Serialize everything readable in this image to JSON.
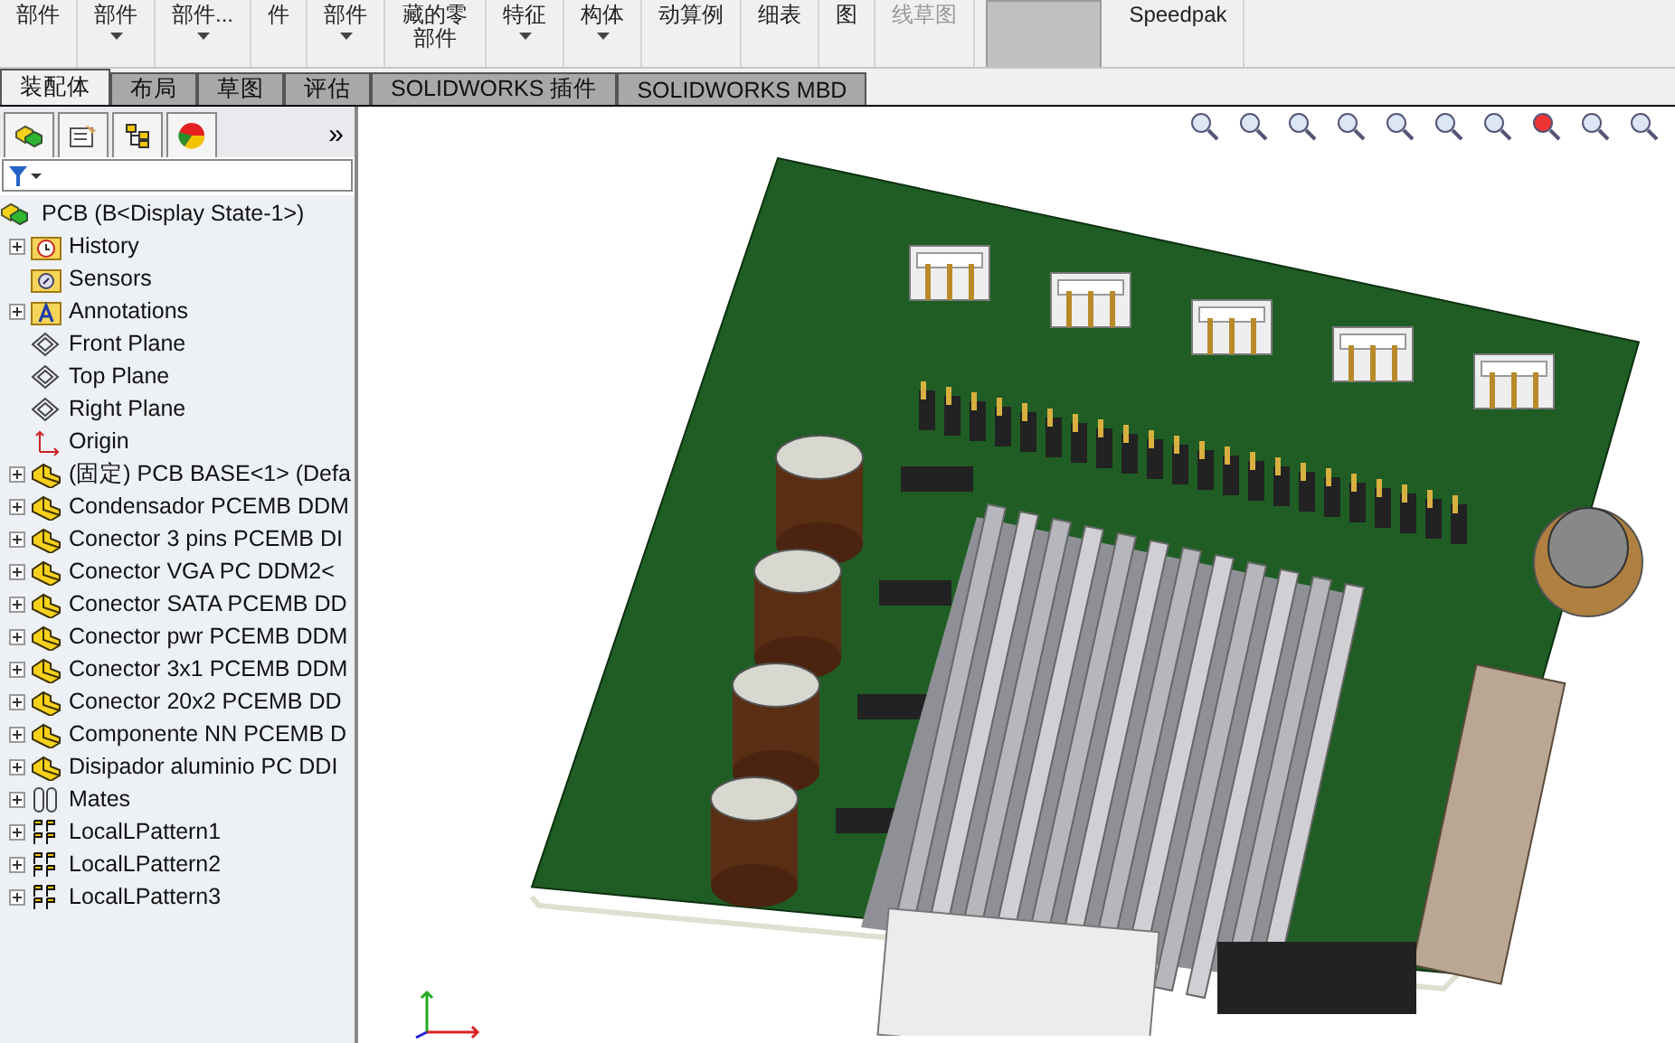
{
  "ribbon": [
    {
      "label": "部件",
      "caret": false,
      "disabled": false
    },
    {
      "label": "部件",
      "caret": true,
      "disabled": false
    },
    {
      "label": "部件...",
      "caret": true,
      "disabled": false
    },
    {
      "label": "件",
      "caret": false,
      "disabled": false
    },
    {
      "label": "部件",
      "caret": true,
      "disabled": false
    },
    {
      "label": "藏的零部件",
      "caret": false,
      "disabled": false
    },
    {
      "label": "特征",
      "caret": true,
      "disabled": false
    },
    {
      "label": "构体",
      "caret": true,
      "disabled": false
    },
    {
      "label": "动算例",
      "caret": false,
      "disabled": false
    },
    {
      "label": "细表",
      "caret": false,
      "disabled": false
    },
    {
      "label": "图",
      "caret": false,
      "disabled": false
    },
    {
      "label": "线草图",
      "caret": false,
      "disabled": true
    },
    {
      "label": "Speedpak",
      "caret": false,
      "disabled": false
    }
  ],
  "tabs": [
    {
      "label": "装配体",
      "selected": true
    },
    {
      "label": "布局",
      "selected": false
    },
    {
      "label": "草图",
      "selected": false
    },
    {
      "label": "评估",
      "selected": false
    },
    {
      "label": "SOLIDWORKS 插件",
      "selected": false
    },
    {
      "label": "SOLIDWORKS MBD",
      "selected": false
    }
  ],
  "panel_more": "»",
  "tree": {
    "label": "PCB  (B<Display State-1>)",
    "kind": "assembly",
    "children": [
      {
        "label": "History",
        "kind": "history",
        "expandable": true
      },
      {
        "label": "Sensors",
        "kind": "sensors",
        "expandable": false
      },
      {
        "label": "Annotations",
        "kind": "annotations",
        "expandable": true
      },
      {
        "label": "Front Plane",
        "kind": "plane",
        "expandable": false
      },
      {
        "label": "Top Plane",
        "kind": "plane",
        "expandable": false
      },
      {
        "label": "Right Plane",
        "kind": "plane",
        "expandable": false
      },
      {
        "label": "Origin",
        "kind": "origin",
        "expandable": false
      },
      {
        "label": "(固定) PCB BASE<1> (Defa",
        "kind": "part",
        "expandable": true
      },
      {
        "label": "Condensador PCEMB DDM",
        "kind": "part",
        "expandable": true
      },
      {
        "label": "Conector 3 pins PCEMB DI",
        "kind": "part",
        "expandable": true
      },
      {
        "label": "Conector VGA PC DDM2<",
        "kind": "part",
        "expandable": true
      },
      {
        "label": "Conector SATA PCEMB DD",
        "kind": "part",
        "expandable": true
      },
      {
        "label": "Conector pwr PCEMB DDM",
        "kind": "part",
        "expandable": true
      },
      {
        "label": "Conector 3x1 PCEMB DDM",
        "kind": "part",
        "expandable": true
      },
      {
        "label": "Conector 20x2 PCEMB DD",
        "kind": "part",
        "expandable": true
      },
      {
        "label": "Componente NN PCEMB D",
        "kind": "part",
        "expandable": true
      },
      {
        "label": "Disipador aluminio PC DDI",
        "kind": "part",
        "expandable": true
      },
      {
        "label": "Mates",
        "kind": "mates",
        "expandable": true
      },
      {
        "label": "LocalLPattern1",
        "kind": "pattern",
        "expandable": true
      },
      {
        "label": "LocalLPattern2",
        "kind": "pattern",
        "expandable": true
      },
      {
        "label": "LocalLPattern3",
        "kind": "pattern",
        "expandable": true
      }
    ]
  }
}
